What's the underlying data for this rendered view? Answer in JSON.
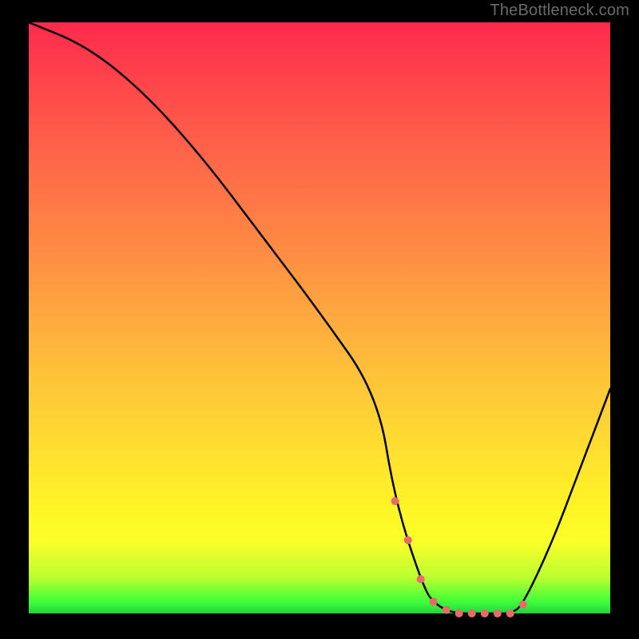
{
  "watermark": "TheBottleneck.com",
  "chart_data": {
    "type": "line",
    "title": "",
    "xlabel": "",
    "ylabel": "",
    "xlim": [
      0,
      100
    ],
    "ylim": [
      0,
      100
    ],
    "series": [
      {
        "name": "curve",
        "x": [
          0,
          10,
          20,
          30,
          40,
          50,
          60,
          63,
          68,
          70,
          73,
          78,
          80,
          83,
          85,
          90,
          95,
          100
        ],
        "values": [
          100,
          96,
          88,
          77,
          64,
          51,
          37,
          19,
          4,
          1.5,
          0.0,
          0.0,
          0.0,
          0.0,
          1.5,
          12,
          25,
          38
        ]
      }
    ],
    "annotations": {
      "marker_band_x_pct": [
        63,
        85
      ],
      "marker_count": 11,
      "marker_color": "#e86a6a",
      "marker_radius_px": 5
    }
  }
}
